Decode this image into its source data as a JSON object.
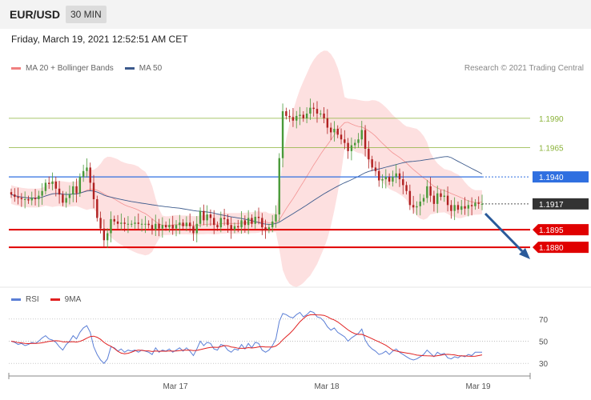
{
  "header": {
    "symbol": "EUR/USD",
    "timeframe": "30 MIN"
  },
  "datetime": "Friday, March 19, 2021 12:52:51 AM CET",
  "legend": {
    "ma20": {
      "label": "MA 20 + Bollinger Bands",
      "color": "#f08080"
    },
    "ma50": {
      "label": "MA 50",
      "color": "#3c5a8c"
    }
  },
  "credit": "Research © 2021 Trading Central",
  "rsi_legend": {
    "rsi": {
      "label": "RSI",
      "color": "#5b7fd6"
    },
    "ma9": {
      "label": "9MA",
      "color": "#e02020"
    }
  },
  "chart_data": [
    {
      "type": "candlestick",
      "title": "",
      "x_labels": [
        "Mar 17",
        "Mar 18",
        "Mar 19"
      ],
      "ylim": [
        1.1848,
        1.2024
      ],
      "levels": [
        {
          "value": 1.199,
          "label": "1.1990",
          "kind": "target",
          "color": "#8bb33a"
        },
        {
          "value": 1.1965,
          "label": "1.1965",
          "kind": "target",
          "color": "#8bb33a"
        },
        {
          "value": 1.194,
          "label": "1.1940",
          "kind": "pivot",
          "color": "#2f6fe0"
        },
        {
          "value": 1.1917,
          "label": "1.1917",
          "kind": "last",
          "color": "#333333"
        },
        {
          "value": 1.1895,
          "label": "1.1895",
          "kind": "support",
          "color": "#e00000"
        },
        {
          "value": 1.188,
          "label": "1.1880",
          "kind": "support",
          "color": "#e00000"
        }
      ],
      "up_color": "#4a9a3a",
      "down_color": "#b02020",
      "band_color": "#fde0e0",
      "close_series": [
        1.1925,
        1.1923,
        1.1922,
        1.1921,
        1.1921,
        1.192,
        1.1922,
        1.1921,
        1.1924,
        1.1928,
        1.1935,
        1.1934,
        1.1936,
        1.193,
        1.1925,
        1.1918,
        1.1922,
        1.1925,
        1.1932,
        1.1926,
        1.194,
        1.1945,
        1.1948,
        1.1935,
        1.1921,
        1.1905,
        1.1896,
        1.1886,
        1.1892,
        1.1904,
        1.1902,
        1.19,
        1.1901,
        1.19,
        1.19,
        1.19,
        1.1901,
        1.19,
        1.19,
        1.19,
        1.1899,
        1.1895,
        1.19,
        1.1896,
        1.1899,
        1.1897,
        1.1899,
        1.1896,
        1.1899,
        1.1901,
        1.1898,
        1.1901,
        1.1898,
        1.1892,
        1.19,
        1.1911,
        1.1903,
        1.1908,
        1.1905,
        1.1899,
        1.1897,
        1.1905,
        1.1904,
        1.1899,
        1.1895,
        1.1898,
        1.1897,
        1.1903,
        1.1899,
        1.1905,
        1.19,
        1.1906,
        1.1905,
        1.1897,
        1.1895,
        1.1897,
        1.1902,
        1.1908,
        1.1956,
        1.1996,
        1.1992,
        1.1991,
        1.1988,
        1.1992,
        1.1993,
        1.199,
        1.1994,
        1.1999,
        1.1998,
        1.1994,
        1.1994,
        1.199,
        1.1982,
        1.1978,
        1.1981,
        1.1976,
        1.1972,
        1.1969,
        1.1962,
        1.1967,
        1.1969,
        1.1972,
        1.198,
        1.1964,
        1.1955,
        1.1948,
        1.1945,
        1.1937,
        1.1938,
        1.194,
        1.1936,
        1.194,
        1.1943,
        1.1938,
        1.1933,
        1.1928,
        1.1916,
        1.1914,
        1.1915,
        1.1919,
        1.1922,
        1.1932,
        1.1924,
        1.1917,
        1.1926,
        1.1923,
        1.1924,
        1.1916,
        1.1911,
        1.1916,
        1.1912,
        1.1915,
        1.1913,
        1.1916,
        1.1915,
        1.1918,
        1.1917,
        1.1917
      ]
    },
    {
      "type": "line",
      "title": "",
      "ylim": [
        20,
        80
      ],
      "yticks": [
        30,
        50,
        70
      ],
      "series": [
        {
          "name": "RSI"
        },
        {
          "name": "9MA"
        }
      ],
      "rsi_values": [
        50,
        49,
        47,
        48,
        46,
        47,
        49,
        48,
        50,
        53,
        55,
        52,
        51,
        49,
        45,
        42,
        47,
        50,
        55,
        52,
        58,
        62,
        64,
        58,
        45,
        38,
        33,
        30,
        34,
        45,
        44,
        41,
        43,
        40,
        42,
        41,
        42,
        40,
        42,
        41,
        40,
        38,
        44,
        40,
        42,
        41,
        43,
        40,
        42,
        44,
        41,
        44,
        41,
        37,
        43,
        50,
        46,
        49,
        48,
        43,
        42,
        47,
        46,
        42,
        40,
        43,
        42,
        47,
        43,
        48,
        44,
        49,
        48,
        42,
        40,
        42,
        46,
        52,
        68,
        75,
        74,
        72,
        71,
        74,
        76,
        72,
        74,
        77,
        76,
        72,
        71,
        68,
        63,
        60,
        62,
        58,
        56,
        54,
        50,
        53,
        55,
        57,
        61,
        51,
        46,
        43,
        41,
        38,
        39,
        41,
        38,
        41,
        43,
        40,
        38,
        36,
        34,
        33,
        34,
        36,
        38,
        42,
        39,
        36,
        40,
        38,
        39,
        35,
        34,
        36,
        35,
        37,
        36,
        38,
        37,
        40,
        40,
        40
      ]
    }
  ]
}
